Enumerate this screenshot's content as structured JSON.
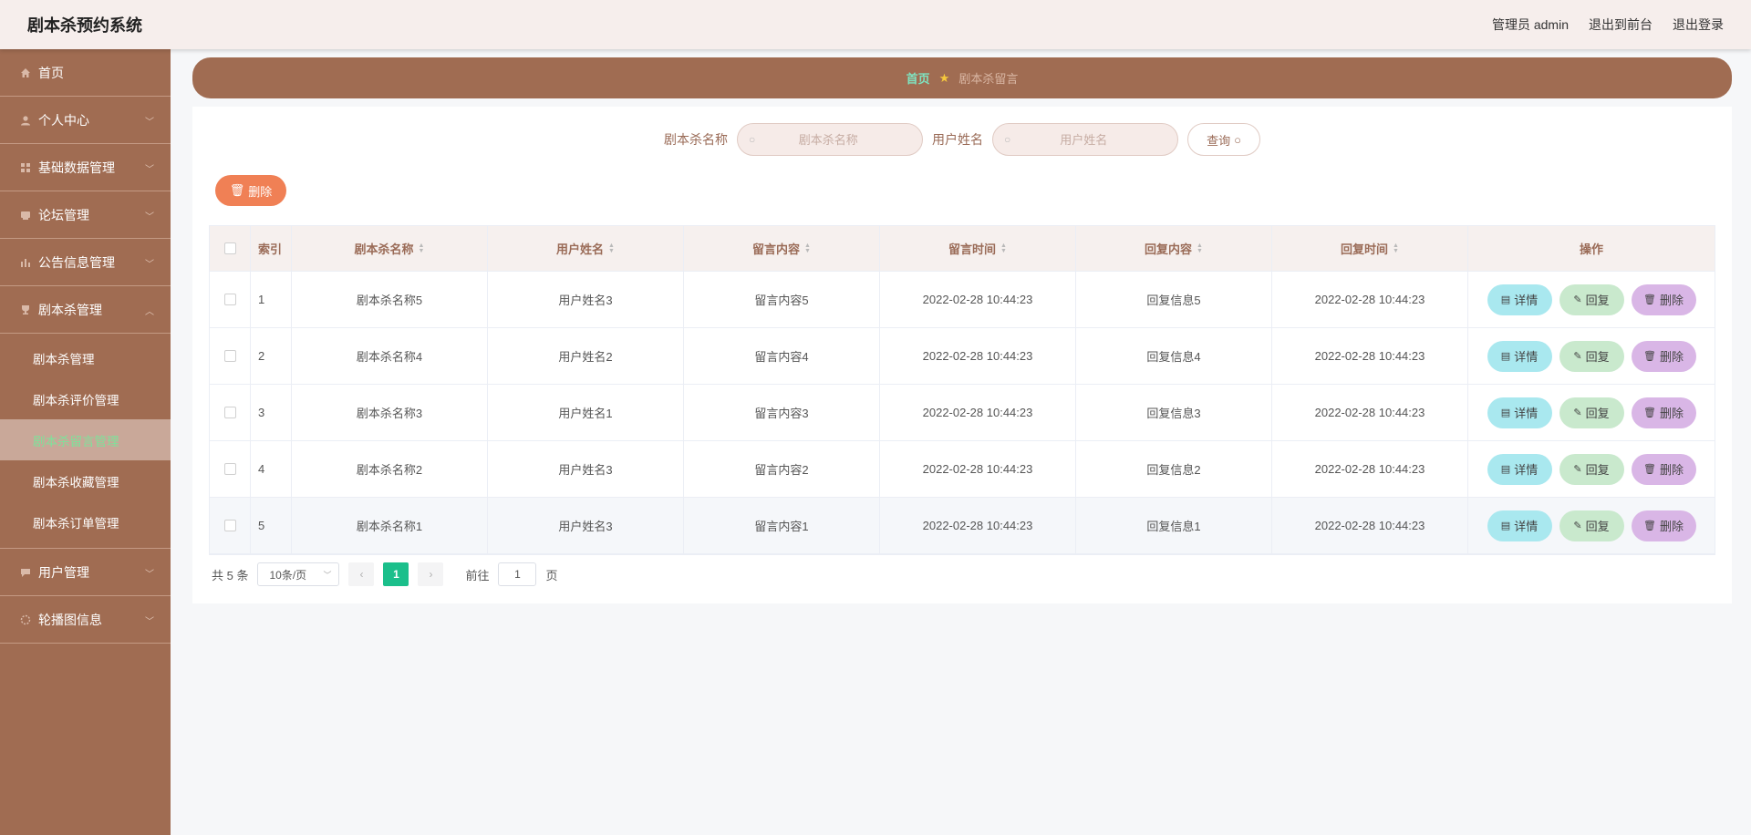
{
  "header": {
    "app_title": "剧本杀预约系统",
    "admin_label": "管理员 admin",
    "to_front_label": "退出到前台",
    "logout_label": "退出登录"
  },
  "sidebar": {
    "items": [
      {
        "label": "首页",
        "icon": "home-icon",
        "has_children": false
      },
      {
        "label": "个人中心",
        "icon": "user-icon",
        "has_children": true
      },
      {
        "label": "基础数据管理",
        "icon": "grid-icon",
        "has_children": true
      },
      {
        "label": "论坛管理",
        "icon": "forum-icon",
        "has_children": true
      },
      {
        "label": "公告信息管理",
        "icon": "bar-chart-icon",
        "has_children": true
      },
      {
        "label": "剧本杀管理",
        "icon": "trophy-icon",
        "has_children": true,
        "expanded": true,
        "children": [
          "剧本杀管理",
          "剧本杀评价管理",
          "剧本杀留言管理",
          "剧本杀收藏管理",
          "剧本杀订单管理"
        ],
        "active_child": "剧本杀留言管理"
      },
      {
        "label": "用户管理",
        "icon": "chat-icon",
        "has_children": true
      },
      {
        "label": "轮播图信息",
        "icon": "carousel-icon",
        "has_children": true
      }
    ]
  },
  "breadcrumb": {
    "home": "首页",
    "current": "剧本杀留言"
  },
  "search": {
    "name_label": "剧本杀名称",
    "name_placeholder": "剧本杀名称",
    "name_value": "",
    "user_label": "用户姓名",
    "user_placeholder": "用户姓名",
    "user_value": "",
    "query_label": "查询"
  },
  "toolbar": {
    "delete_label": "删除"
  },
  "table": {
    "columns": [
      "索引",
      "剧本杀名称",
      "用户姓名",
      "留言内容",
      "留言时间",
      "回复内容",
      "回复时间",
      "操作"
    ],
    "rows": [
      {
        "index": "1",
        "name": "剧本杀名称5",
        "user": "用户姓名3",
        "content": "留言内容5",
        "time": "2022-02-28 10:44:23",
        "reply": "回复信息5",
        "reply_time": "2022-02-28 10:44:23"
      },
      {
        "index": "2",
        "name": "剧本杀名称4",
        "user": "用户姓名2",
        "content": "留言内容4",
        "time": "2022-02-28 10:44:23",
        "reply": "回复信息4",
        "reply_time": "2022-02-28 10:44:23"
      },
      {
        "index": "3",
        "name": "剧本杀名称3",
        "user": "用户姓名1",
        "content": "留言内容3",
        "time": "2022-02-28 10:44:23",
        "reply": "回复信息3",
        "reply_time": "2022-02-28 10:44:23"
      },
      {
        "index": "4",
        "name": "剧本杀名称2",
        "user": "用户姓名3",
        "content": "留言内容2",
        "time": "2022-02-28 10:44:23",
        "reply": "回复信息2",
        "reply_time": "2022-02-28 10:44:23"
      },
      {
        "index": "5",
        "name": "剧本杀名称1",
        "user": "用户姓名3",
        "content": "留言内容1",
        "time": "2022-02-28 10:44:23",
        "reply": "回复信息1",
        "reply_time": "2022-02-28 10:44:23"
      }
    ],
    "actions": {
      "detail": "详情",
      "reply": "回复",
      "delete": "删除"
    }
  },
  "pagination": {
    "total_label": "共 5 条",
    "page_size": "10条/页",
    "current_page": "1",
    "goto_prefix": "前往",
    "goto_value": "1",
    "goto_suffix": "页"
  },
  "colors": {
    "sidebar_bg": "#a06c52",
    "header_bg": "#f6eeec",
    "active_page": "#1bbf8b",
    "detail_btn": "#a9e8ef",
    "reply_btn": "#c9e9cd",
    "delete_btn": "#d9b6e6",
    "main_delete_btn": "#f08055"
  }
}
